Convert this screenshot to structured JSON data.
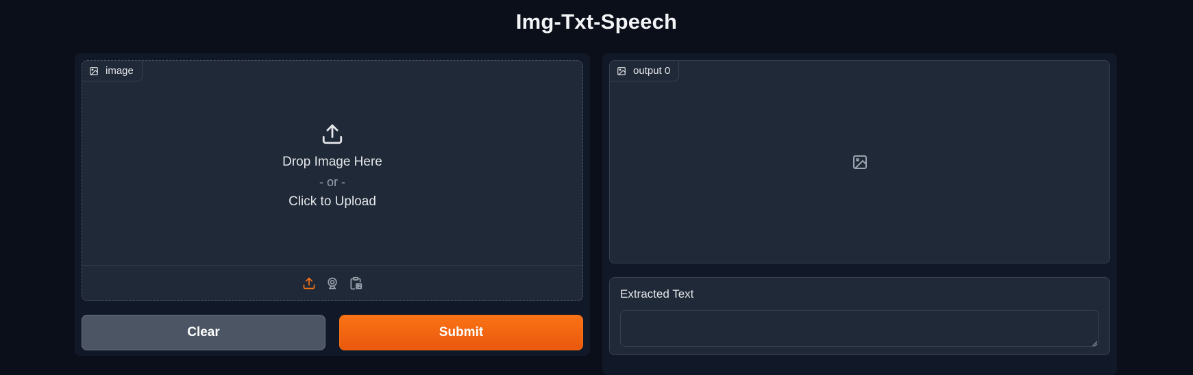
{
  "app": {
    "title": "Img-Txt-Speech"
  },
  "input_image": {
    "label": "image",
    "drop_text": "Drop Image Here",
    "or_text": "- or -",
    "click_text": "Click to Upload",
    "sources": [
      "upload-icon",
      "webcam-icon",
      "clipboard-icon"
    ]
  },
  "buttons": {
    "clear_label": "Clear",
    "submit_label": "Submit"
  },
  "output_image": {
    "label": "output 0"
  },
  "extracted_text": {
    "label": "Extracted Text",
    "value": ""
  },
  "colors": {
    "background": "#0b0f19",
    "panel": "#111827",
    "block": "#1f2937",
    "accent": "#f97316",
    "secondary_button": "#4b5563"
  }
}
